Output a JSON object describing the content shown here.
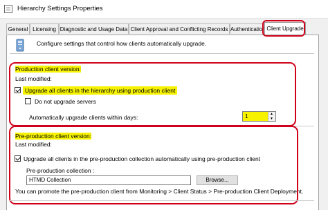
{
  "window": {
    "title": "Hierarchy Settings Properties"
  },
  "tabs": [
    {
      "label": "General"
    },
    {
      "label": "Licensing"
    },
    {
      "label": "Diagnostic and Usage Data"
    },
    {
      "label": "Client Approval and Conflicting Records"
    },
    {
      "label": "Authentication"
    },
    {
      "label": "Client Upgrade"
    }
  ],
  "header": {
    "description": "Configure settings that control how clients automatically upgrade.",
    "icon": "computer-upgrade-icon"
  },
  "production": {
    "version_label": "Production client version:",
    "last_modified_label": "Last modified:",
    "upgrade_all_label": "Upgrade all clients in the hierarchy using production client",
    "upgrade_all_checked": true,
    "no_servers_label": "Do not upgrade servers",
    "no_servers_checked": false,
    "auto_days_label": "Automatically upgrade clients within days:",
    "auto_days_value": "1"
  },
  "preproduction": {
    "version_label": "Pre-production client version:",
    "last_modified_label": "Last modified:",
    "upgrade_all_label": "Upgrade all clients in the pre-production collection automatically using pre-production client",
    "upgrade_all_checked": true,
    "collection_label": "Pre-production collection :",
    "collection_value": "HTMD Collection",
    "browse_label": "Browse...",
    "promote_text": "You can promote the pre-production client from Monitoring > Client Status > Pre-production Client Deployment."
  },
  "colors": {
    "annotation": "#d0021b",
    "highlight": "#f6f200"
  }
}
